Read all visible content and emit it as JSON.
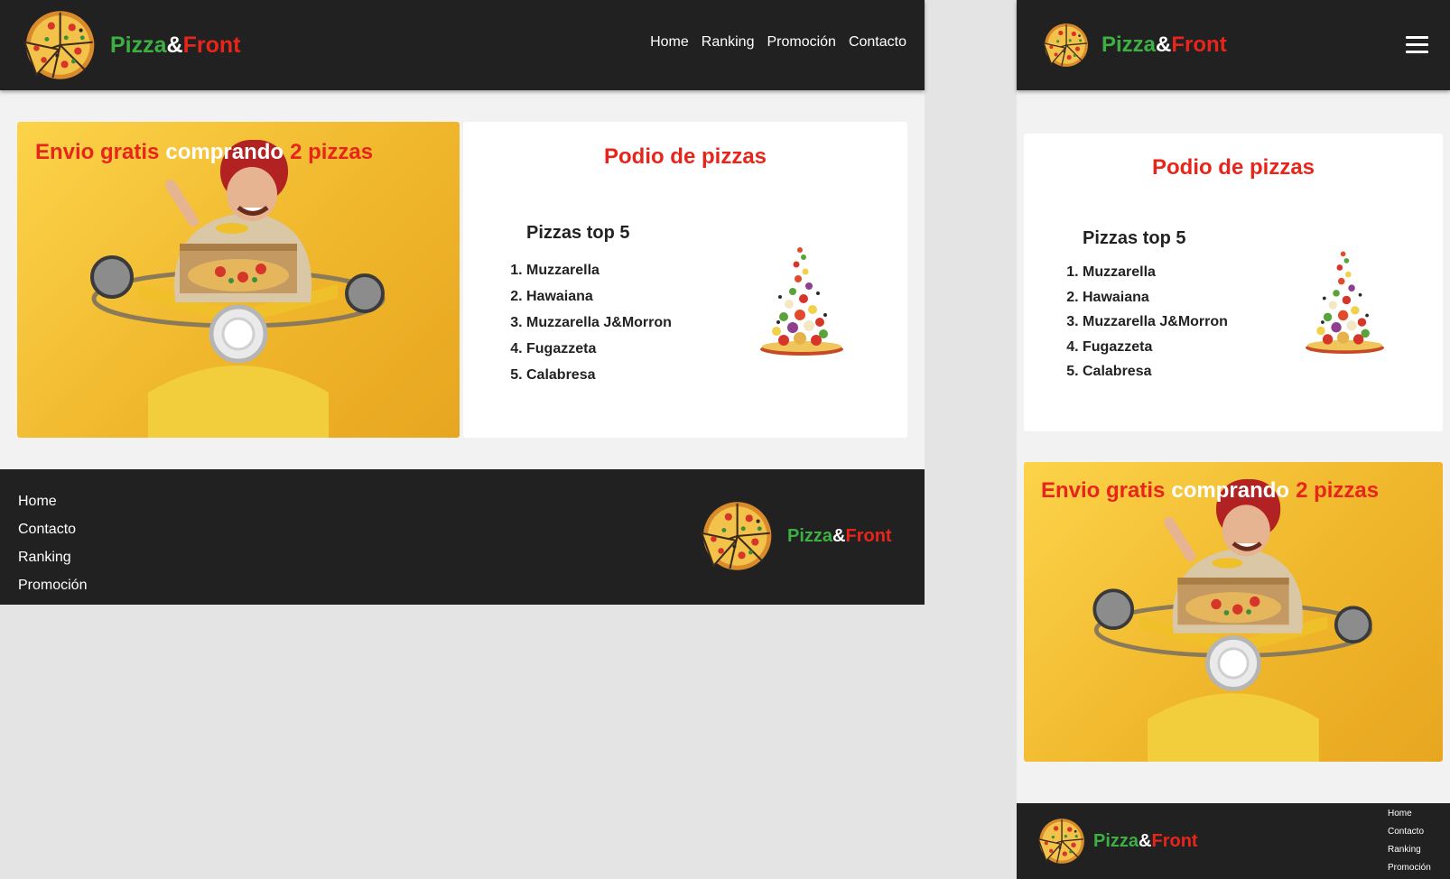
{
  "brand": {
    "part1": "Pizza",
    "part2": "&",
    "part3": "Front"
  },
  "nav": [
    "Home",
    "Ranking",
    "Promoción",
    "Contacto"
  ],
  "promo": {
    "part1": "Envio gratis",
    "part2": "comprando",
    "part3": "2 pizzas"
  },
  "podio": {
    "title": "Podio de pizzas",
    "subtitle": "Pizzas top 5",
    "items": [
      "Muzzarella",
      "Hawaiana",
      "Muzzarella J&Morron",
      "Fugazzeta",
      "Calabresa"
    ]
  },
  "footer_links": [
    "Home",
    "Contacto",
    "Ranking",
    "Promoción"
  ],
  "colors": {
    "header_bg": "#212121",
    "accent_red": "#e8251a",
    "accent_green": "#3cb043",
    "promo_yellow": "#f5c233"
  },
  "icons": {
    "logo": "pizza-logo-icon",
    "menu": "hamburger-menu-icon",
    "pizza_tower": "pizza-tower-illustration"
  }
}
